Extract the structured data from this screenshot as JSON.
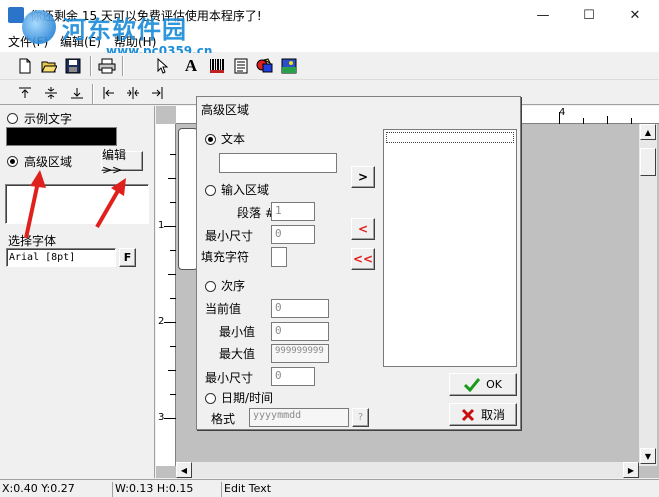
{
  "window": {
    "title": "你还剩余 15 天可以免费评估使用本程序了!",
    "minimize_glyph": "—",
    "maximize_glyph": "☐",
    "close_glyph": "✕"
  },
  "watermark": {
    "name": "河东软件园",
    "url": "www.pc0359.cn"
  },
  "menu": {
    "items": [
      {
        "label": "文件(F)"
      },
      {
        "label": "编辑(E)"
      },
      {
        "label": "帮助(H)"
      }
    ]
  },
  "toolbar": {
    "text_tool_glyph": "A"
  },
  "left_panel": {
    "sample_text_label": "示例文字",
    "advanced_area_label": "高级区域",
    "edit_button": "编辑>>",
    "font_section_label": "选择字体",
    "font_value": "Arial [8pt]",
    "font_button": "F"
  },
  "ruler": {
    "top_numbers": [
      "4"
    ],
    "left_numbers": [
      "1",
      "2",
      "3"
    ]
  },
  "dialog": {
    "title": "高级区域",
    "text_option": "文本",
    "text_value": "",
    "input_area_option": "输入区域",
    "paragraph_label": "段落 #",
    "paragraph_value": "1",
    "min_size_label": "最小尺寸",
    "min_size_value": "0",
    "fill_char_label": "填充字符",
    "fill_char_value": "",
    "sequence_option": "次序",
    "current_label": "当前值",
    "current_value": "0",
    "min_value_label": "最小值",
    "min_value": "0",
    "max_value_label": "最大值",
    "max_value": "999999999",
    "seq_min_size_label": "最小尺寸",
    "seq_min_size_value": "0",
    "datetime_option": "日期/时间",
    "format_label": "格式",
    "format_value": "yyyymmdd",
    "format_help_button": "?",
    "add_button": ">",
    "remove_button": "<",
    "remove_all_button": "<<",
    "ok_button": "OK",
    "cancel_button": "取消"
  },
  "status_bar": {
    "position": "X:0.40  Y:0.27",
    "size": "W:0.13  H:0.15",
    "mode": "Edit Text"
  },
  "colors": {
    "accent_red": "#e0201c",
    "ok_green": "#1a9a1a",
    "cancel_red": "#c81010",
    "watermark_blue": "#1f8ed9"
  }
}
